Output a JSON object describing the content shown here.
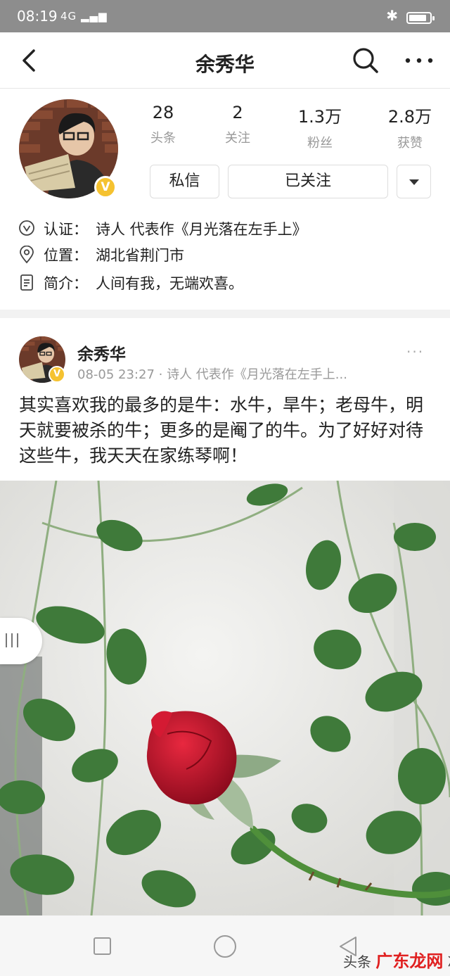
{
  "status_bar": {
    "time": "08:19",
    "signal": "4G"
  },
  "nav": {
    "title": "余秀华"
  },
  "profile": {
    "stats": [
      {
        "value": "28",
        "label": "头条"
      },
      {
        "value": "2",
        "label": "关注"
      },
      {
        "value": "1.3万",
        "label": "粉丝"
      },
      {
        "value": "2.8万",
        "label": "获赞"
      }
    ],
    "message_button": "私信",
    "follow_button": "已关注",
    "info": [
      {
        "icon": "verified-icon",
        "label": "认证：",
        "value": "诗人 代表作《月光落在左手上》"
      },
      {
        "icon": "location-icon",
        "label": "位置：",
        "value": "湖北省荆门市"
      },
      {
        "icon": "document-icon",
        "label": "简介：",
        "value": "人间有我，无端欢喜。"
      }
    ]
  },
  "post": {
    "author": "余秀华",
    "meta": "08-05 23:27 · 诗人 代表作《月光落在左手上...",
    "more": "···",
    "text": "其实喜欢我的最多的是牛：水牛，旱牛；老母牛，明天就要被杀的牛；更多的是阉了的牛。为了好好对待这些牛，我天天在家练琴啊！"
  },
  "watermark": {
    "prefix": "头条",
    "brand": "广东龙网",
    "suffix": "冰"
  },
  "colors": {
    "accent": "#f5c230",
    "rose": "#c8102e",
    "leaf": "#3f7a3a"
  }
}
